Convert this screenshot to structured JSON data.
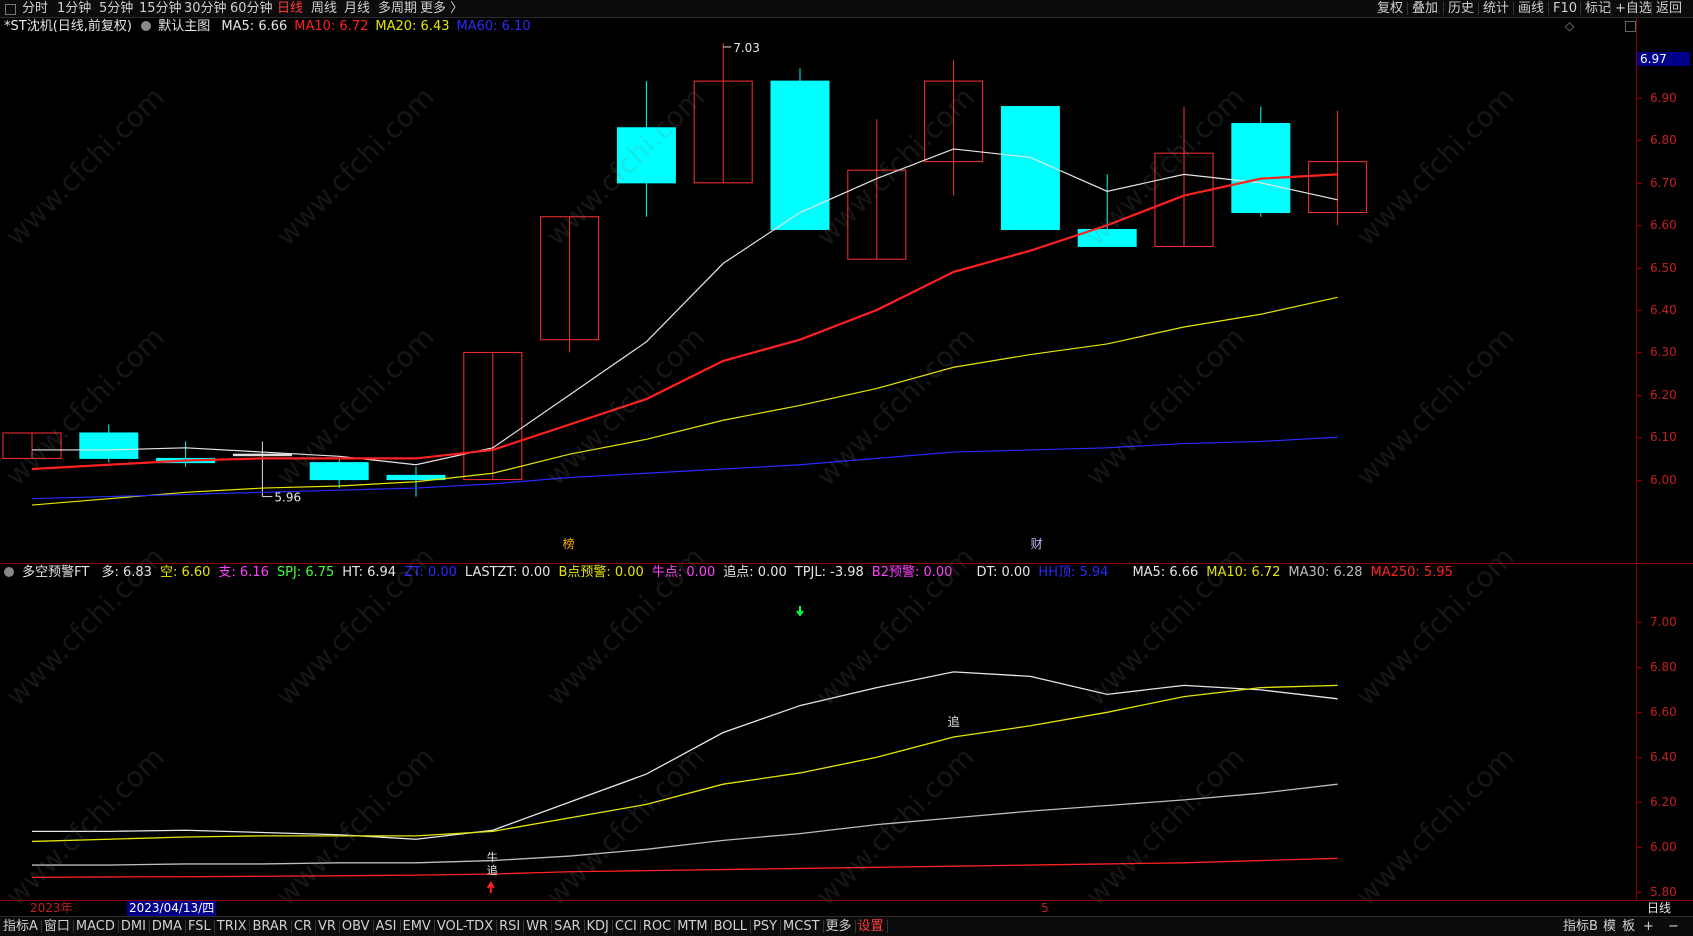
{
  "topbar": {
    "periods": [
      "分时",
      "1分钟",
      "5分钟",
      "15分钟",
      "30分钟",
      "60分钟",
      "日线",
      "周线",
      "月线",
      "多周期",
      "更多 〉"
    ],
    "active_period": "日线",
    "right_buttons": [
      "复权",
      "叠加",
      "历史",
      "统计",
      "画线",
      "F10",
      "标记",
      "+自选",
      "返回"
    ]
  },
  "main_header": {
    "title": "*ST沈机(日线,前复权)",
    "chart_mode": "默认主图",
    "ma": [
      {
        "label": "MA5: 6.66",
        "color": "#e6e6e6"
      },
      {
        "label": "MA10: 6.72",
        "color": "#ff2020"
      },
      {
        "label": "MA20: 6.43",
        "color": "#e6e600"
      },
      {
        "label": "MA60: 6.10",
        "color": "#2a2aff"
      }
    ],
    "diamond": "◇",
    "current_price": "6.97"
  },
  "sub_header": {
    "name": "多空预警FT",
    "items": [
      {
        "label": "多: 6.83",
        "color": "#e6e6e6"
      },
      {
        "label": "空: 6.60",
        "color": "#e6e600"
      },
      {
        "label": "支: 6.16",
        "color": "#ff40ff"
      },
      {
        "label": "SPJ: 6.75",
        "color": "#40ff40"
      },
      {
        "label": "HT: 6.94",
        "color": "#e6e6e6"
      },
      {
        "label": "ZT: 0.00",
        "color": "#2a2aff"
      },
      {
        "label": "LASTZT: 0.00",
        "color": "#e6e6e6"
      },
      {
        "label": "B点预警: 0.00",
        "color": "#e6e600"
      },
      {
        "label": "牛点: 0.00",
        "color": "#ff40ff"
      },
      {
        "label": "追点: 0.00",
        "color": "#e6e6e6"
      },
      {
        "label": "TPJL: -3.98",
        "color": "#e6e6e6"
      },
      {
        "label": "B2预警: 0.00",
        "color": "#ff40ff"
      },
      {
        "label": "DT: 0.00",
        "color": "#e6e6e6"
      },
      {
        "label": "HH顶: 5.94",
        "color": "#2a2aff"
      },
      {
        "label": "MA5: 6.66",
        "color": "#e6e6e6"
      },
      {
        "label": "MA10: 6.72",
        "color": "#e6e600"
      },
      {
        "label": "MA30: 6.28",
        "color": "#bdbdbd"
      },
      {
        "label": "MA250: 5.95",
        "color": "#ff2020"
      }
    ]
  },
  "main_axis_ticks": [
    "6.90",
    "6.80",
    "6.70",
    "6.60",
    "6.50",
    "6.40",
    "6.30",
    "6.20",
    "6.10",
    "6.00"
  ],
  "sub_axis_ticks": [
    "7.00",
    "6.80",
    "6.60",
    "6.40",
    "6.20",
    "6.00",
    "5.80"
  ],
  "annotations": {
    "high": "7.03",
    "low": "5.96",
    "bang": "榜",
    "cai": "财",
    "zhui_upper": "追",
    "niu": "牛",
    "zhui_lower": "追"
  },
  "date_axis": {
    "year_label": "2023年",
    "cursor_date": "2023/04/13/四",
    "month_mark": "5",
    "period_label": "日线"
  },
  "bottombar": {
    "items": [
      "指标A",
      "窗口",
      "MACD",
      "DMI",
      "DMA",
      "FSL",
      "TRIX",
      "BRAR",
      "CR",
      "VR",
      "OBV",
      "ASI",
      "EMV",
      "VOL-TDX",
      "RSI",
      "WR",
      "SAR",
      "KDJ",
      "CCI",
      "ROC",
      "MTM",
      "BOLL",
      "PSY",
      "MCST",
      "更多",
      "设置"
    ],
    "right_items": [
      "指标B",
      "模",
      "板",
      "+",
      "−"
    ]
  },
  "watermark_text": "www.cfchi.com",
  "chart_data": [
    {
      "type": "candlestick",
      "title": "*ST沈机(日线,前复权)",
      "ylim": [
        5.9,
        7.07
      ],
      "grid": false,
      "candles": [
        {
          "o": 6.05,
          "h": 6.11,
          "l": 6.05,
          "c": 6.11,
          "dir": "up"
        },
        {
          "o": 6.11,
          "h": 6.13,
          "l": 6.04,
          "c": 6.05,
          "dir": "down"
        },
        {
          "o": 6.05,
          "h": 6.09,
          "l": 6.03,
          "c": 6.04,
          "dir": "down"
        },
        {
          "o": 6.06,
          "h": 6.09,
          "l": 5.96,
          "c": 6.06,
          "dir": "flat"
        },
        {
          "o": 6.04,
          "h": 6.05,
          "l": 5.98,
          "c": 6.0,
          "dir": "down"
        },
        {
          "o": 6.01,
          "h": 6.03,
          "l": 5.96,
          "c": 6.0,
          "dir": "down"
        },
        {
          "o": 6.0,
          "h": 6.3,
          "l": 6.0,
          "c": 6.3,
          "dir": "up"
        },
        {
          "o": 6.33,
          "h": 6.62,
          "l": 6.3,
          "c": 6.62,
          "dir": "up"
        },
        {
          "o": 6.83,
          "h": 6.94,
          "l": 6.62,
          "c": 6.7,
          "dir": "down"
        },
        {
          "o": 6.7,
          "h": 7.03,
          "l": 6.7,
          "c": 6.94,
          "dir": "up"
        },
        {
          "o": 6.94,
          "h": 6.97,
          "l": 6.59,
          "c": 6.59,
          "dir": "down"
        },
        {
          "o": 6.52,
          "h": 6.85,
          "l": 6.52,
          "c": 6.73,
          "dir": "up"
        },
        {
          "o": 6.75,
          "h": 6.99,
          "l": 6.67,
          "c": 6.94,
          "dir": "up"
        },
        {
          "o": 6.88,
          "h": 6.88,
          "l": 6.59,
          "c": 6.59,
          "dir": "down"
        },
        {
          "o": 6.59,
          "h": 6.72,
          "l": 6.55,
          "c": 6.55,
          "dir": "down"
        },
        {
          "o": 6.55,
          "h": 6.88,
          "l": 6.55,
          "c": 6.77,
          "dir": "up"
        },
        {
          "o": 6.84,
          "h": 6.88,
          "l": 6.62,
          "c": 6.63,
          "dir": "down"
        },
        {
          "o": 6.63,
          "h": 6.87,
          "l": 6.6,
          "c": 6.75,
          "dir": "up"
        }
      ],
      "series": [
        {
          "name": "MA5",
          "color": "#e6e6e6",
          "values": [
            6.07,
            6.07,
            6.075,
            6.065,
            6.055,
            6.035,
            6.075,
            6.2,
            6.325,
            6.51,
            6.63,
            6.71,
            6.78,
            6.76,
            6.68,
            6.72,
            6.7,
            6.66
          ]
        },
        {
          "name": "MA10",
          "color": "#ff2020",
          "values": [
            6.025,
            6.035,
            6.045,
            6.05,
            6.05,
            6.05,
            6.07,
            6.13,
            6.19,
            6.28,
            6.33,
            6.4,
            6.49,
            6.54,
            6.6,
            6.67,
            6.71,
            6.72
          ]
        },
        {
          "name": "MA20",
          "color": "#e6e600",
          "values": [
            5.94,
            5.955,
            5.97,
            5.98,
            5.985,
            5.995,
            6.015,
            6.06,
            6.095,
            6.14,
            6.175,
            6.215,
            6.265,
            6.295,
            6.32,
            6.36,
            6.39,
            6.43
          ]
        },
        {
          "name": "MA60",
          "color": "#2a2aff",
          "values": [
            5.955,
            5.96,
            5.965,
            5.97,
            5.975,
            5.98,
            5.99,
            6.005,
            6.015,
            6.025,
            6.035,
            6.05,
            6.065,
            6.07,
            6.075,
            6.085,
            6.09,
            6.1
          ]
        }
      ]
    },
    {
      "type": "line",
      "title": "多空预警FT",
      "ylim": [
        5.8,
        7.1
      ],
      "grid": false,
      "series": [
        {
          "name": "MA5",
          "color": "#e6e6e6",
          "values": [
            6.07,
            6.07,
            6.075,
            6.065,
            6.055,
            6.035,
            6.075,
            6.2,
            6.325,
            6.51,
            6.63,
            6.71,
            6.78,
            6.76,
            6.68,
            6.72,
            6.7,
            6.66
          ]
        },
        {
          "name": "MA10",
          "color": "#e6e600",
          "values": [
            6.025,
            6.035,
            6.045,
            6.05,
            6.05,
            6.05,
            6.07,
            6.13,
            6.19,
            6.28,
            6.33,
            6.4,
            6.49,
            6.54,
            6.6,
            6.67,
            6.71,
            6.72
          ]
        },
        {
          "name": "MA30",
          "color": "#bdbdbd",
          "values": [
            5.92,
            5.92,
            5.925,
            5.925,
            5.93,
            5.93,
            5.94,
            5.96,
            5.99,
            6.03,
            6.06,
            6.1,
            6.13,
            6.16,
            6.185,
            6.21,
            6.24,
            6.28
          ]
        },
        {
          "name": "MA250",
          "color": "#ff2020",
          "values": [
            5.865,
            5.867,
            5.868,
            5.87,
            5.872,
            5.875,
            5.88,
            5.89,
            5.895,
            5.9,
            5.905,
            5.91,
            5.915,
            5.92,
            5.925,
            5.93,
            5.94,
            5.95
          ]
        }
      ]
    }
  ]
}
